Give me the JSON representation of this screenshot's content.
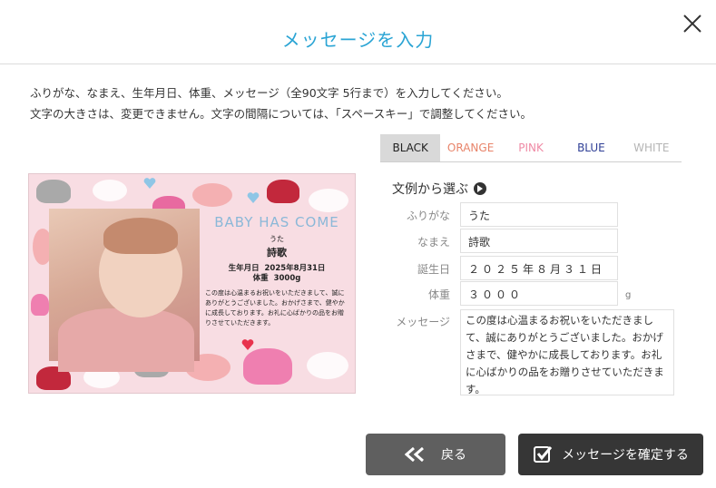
{
  "dialog": {
    "title": "メッセージを入力"
  },
  "instructions": {
    "line1": "ふりがな、なまえ、生年月日、体重、メッセージ（全90文字 5行まで）を入力してください。",
    "line2": "文字の大きさは、変更できません。文字の間隔については、「スペースキー」で調整してください。"
  },
  "color_tabs": [
    {
      "label": "BLACK",
      "color": "#222222",
      "active": true
    },
    {
      "label": "ORANGE",
      "color": "#e8846a",
      "active": false
    },
    {
      "label": "PINK",
      "color": "#ef8aa5",
      "active": false
    },
    {
      "label": "BLUE",
      "color": "#2f3f96",
      "active": false
    },
    {
      "label": "WHITE",
      "color": "#b5b5b5",
      "active": false
    }
  ],
  "card": {
    "headline": "BABY HAS COME",
    "furigana": "うた",
    "name": "詩歌",
    "dob_label": "生年月日",
    "dob": "2025年8月31日",
    "weight_label": "体重",
    "weight": "3000g",
    "message": "この度は心温まるお祝いをいただきまして、誠にありがとうございました。おかげさまで、健やかに成長しております。お礼に心ばかりの品をお贈りさせていただきます。"
  },
  "form": {
    "examples_label": "文例から選ぶ",
    "furigana_label": "ふりがな",
    "furigana_value": "うた",
    "name_label": "なまえ",
    "name_value": "詩歌",
    "dob_label": "誕生日",
    "dob_value": "２０２５年８月３１日",
    "weight_label": "体重",
    "weight_value": "３０００",
    "weight_unit": "g",
    "message_label": "メッセージ",
    "message_value": "この度は心温まるお祝いをいただきまして、誠にありがとうございました。おかげさまで、健やかに成長しております。お礼に心ばかりの品をお贈りさせていただきます。"
  },
  "buttons": {
    "back_label": "戻る",
    "confirm_label": "メッセージを確定する"
  },
  "icons": {
    "close": "close-icon",
    "back": "double-chevron-left-icon",
    "confirm": "checkbox-icon",
    "examples": "circle-arrow-right-icon"
  },
  "colors": {
    "title": "#2aa4d4",
    "card_bg": "#f8dde3",
    "back_button": "#5f5f5f",
    "confirm_button": "#363636"
  }
}
